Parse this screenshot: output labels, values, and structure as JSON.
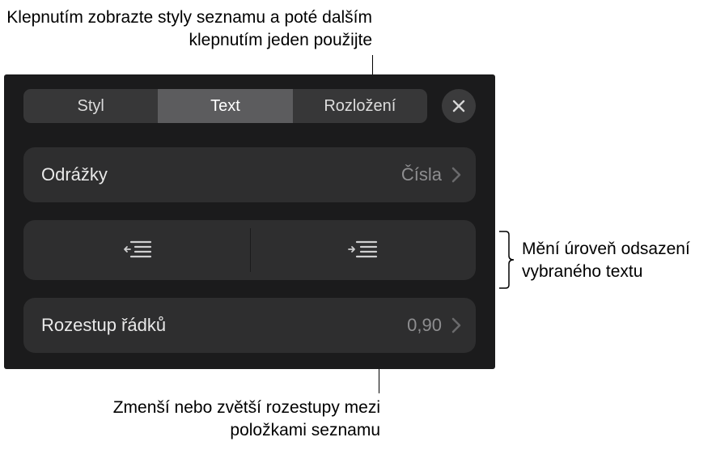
{
  "callouts": {
    "top": "Klepnutím zobrazte styly seznamu a poté dalším klepnutím jeden použijte",
    "right": "Mění úroveň odsazení vybraného textu",
    "bottom": "Zmenší nebo zvětší rozestupy mezi položkami seznamu"
  },
  "tabs": {
    "style": "Styl",
    "text": "Text",
    "layout": "Rozložení"
  },
  "rows": {
    "bullets": {
      "label": "Odrážky",
      "value": "Čísla"
    },
    "lineSpacing": {
      "label": "Rozestup řádků",
      "value": "0,90"
    }
  },
  "icons": {
    "close": "close-icon",
    "chevron": "chevron-right-icon",
    "outdent": "decrease-indent-icon",
    "indent": "increase-indent-icon"
  }
}
